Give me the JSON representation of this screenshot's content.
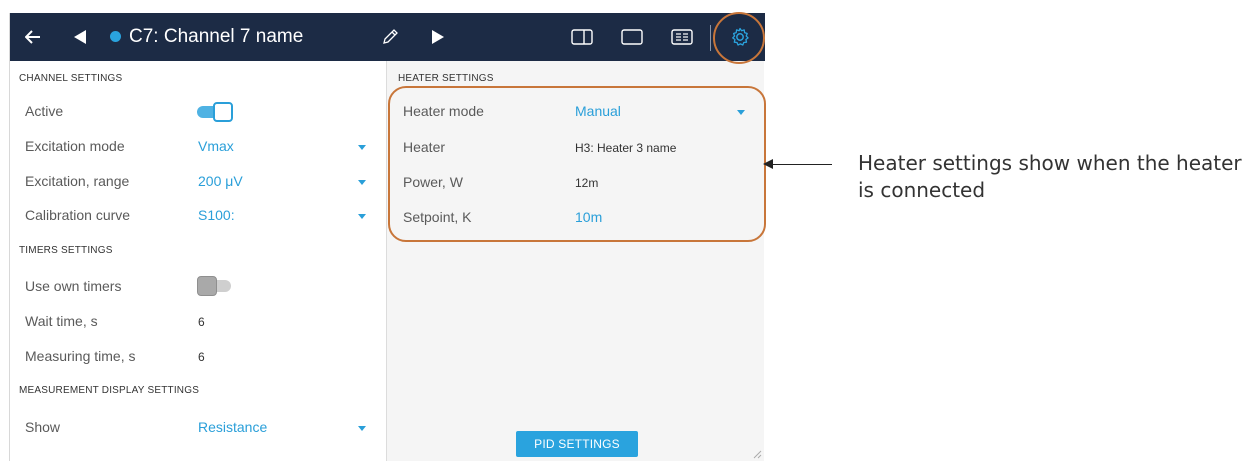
{
  "header": {
    "title": "C7: Channel 7 name",
    "icons": [
      "back-arrow-icon",
      "previous-triangle-icon",
      "status-dot-icon",
      "pencil-icon",
      "play-icon",
      "split-view-icon",
      "single-view-icon",
      "list-view-icon",
      "gear-icon"
    ],
    "status_dot_color": "#2aa3de"
  },
  "channel_settings": {
    "heading": "CHANNEL SETTINGS",
    "active_label": "Active",
    "active_on": true,
    "excitation_mode_label": "Excitation mode",
    "excitation_mode_value": "Vmax",
    "excitation_range_label": "Excitation, range",
    "excitation_range_value": "200 μV",
    "calibration_curve_label": "Calibration curve",
    "calibration_curve_value": "S100:"
  },
  "timers_settings": {
    "heading": "TIMERS SETTINGS",
    "use_own_timers_label": "Use own timers",
    "use_own_timers_on": false,
    "wait_time_label": "Wait time, s",
    "wait_time_value": "6",
    "measuring_time_label": "Measuring time, s",
    "measuring_time_value": "6"
  },
  "measurement_display": {
    "heading": "MEASUREMENT DISPLAY SETTINGS",
    "show_label": "Show",
    "show_value": "Resistance"
  },
  "heater_settings": {
    "heading": "HEATER SETTINGS",
    "mode_label": "Heater mode",
    "mode_value": "Manual",
    "heater_label": "Heater",
    "heater_value": "H3: Heater 3 name",
    "power_label": "Power, W",
    "power_value": "12m",
    "setpoint_label": "Setpoint, K",
    "setpoint_value": "10m",
    "pid_button_label": "PID SETTINGS"
  },
  "annotation": {
    "callout_text": "Heater settings show when the heater is connected",
    "highlight_color": "#c8763a"
  },
  "colors": {
    "topbar": "#1c2b45",
    "accent": "#2aa3de"
  }
}
